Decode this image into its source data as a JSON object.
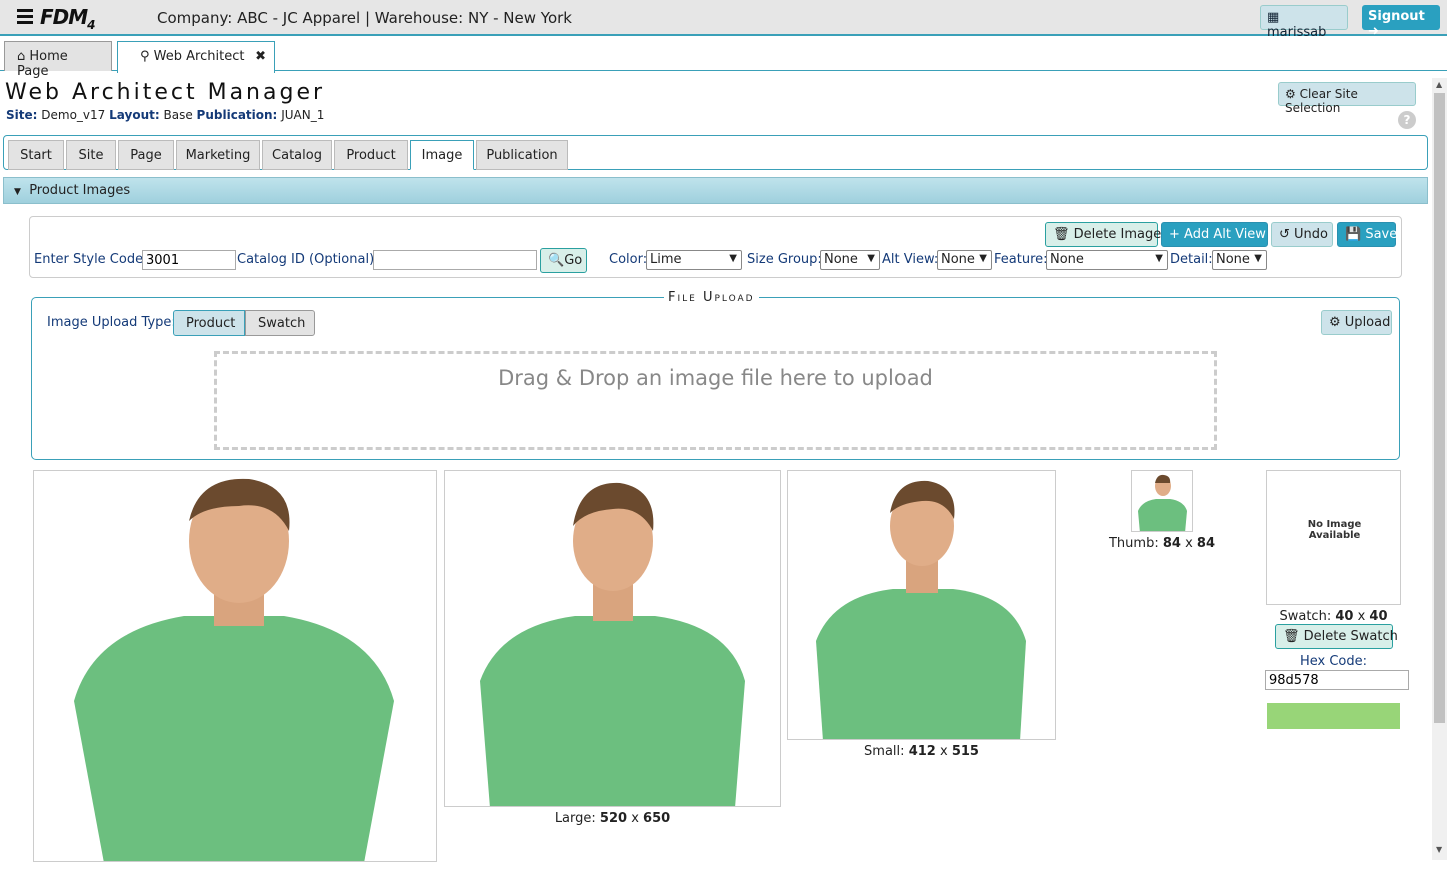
{
  "app": {
    "logo_text": "FDM",
    "logo_version": "4",
    "company_line": "Company: ABC - JC Apparel  | Warehouse: NY - New York",
    "user": "marissab",
    "signout": "Signout"
  },
  "page_tabs": [
    {
      "label": "Home Page"
    },
    {
      "label": "Web Architect"
    }
  ],
  "header": {
    "title": "Web Architect Manager",
    "site_label": "Site:",
    "site": "Demo_v17",
    "layout_label": "Layout:",
    "layout": "Base",
    "pub_label": "Publication:",
    "publication": "JUAN_1",
    "clear_btn": "Clear Site Selection",
    "help": "?"
  },
  "main_tabs": [
    "Start",
    "Site",
    "Page",
    "Marketing",
    "Catalog",
    "Product",
    "Image",
    "Publication"
  ],
  "active_tab": "Image",
  "section_title": "Product Images",
  "toolbar": {
    "delete_image": "Delete Image",
    "add_alt_view": "Add Alt View",
    "undo": "Undo",
    "save": "Save"
  },
  "form": {
    "style_label": "Enter Style Code:",
    "style_value": "3001",
    "catalog_label": "Catalog ID (Optional):",
    "catalog_value": "",
    "go": "Go",
    "color_label": "Color:",
    "color_value": "Lime",
    "size_label": "Size Group:",
    "size_value": "None",
    "alt_label": "Alt View:",
    "alt_value": "None",
    "feature_label": "Feature:",
    "feature_value": "None",
    "detail_label": "Detail:",
    "detail_value": "None"
  },
  "upload": {
    "legend": "File Upload",
    "type_label": "Image Upload Type:",
    "type_product": "Product",
    "type_swatch": "Swatch",
    "upload_btn": "Upload",
    "drop_text": "Drag & Drop an image file here to upload"
  },
  "images": {
    "large": {
      "label": "Large:",
      "w": "520",
      "h": "650"
    },
    "small": {
      "label": "Small:",
      "w": "412",
      "h": "515"
    },
    "thumb": {
      "label": "Thumb:",
      "w": "84",
      "h": "84"
    },
    "swatch": {
      "label": "Swatch:",
      "w": "40",
      "h": "40",
      "no_image": "No Image Available",
      "delete": "Delete Swatch",
      "hex_label": "Hex Code:",
      "hex_value": "98d578"
    },
    "x": "x",
    "shirt_color": "#6cbf7f",
    "swatch_color": "#98d578"
  }
}
